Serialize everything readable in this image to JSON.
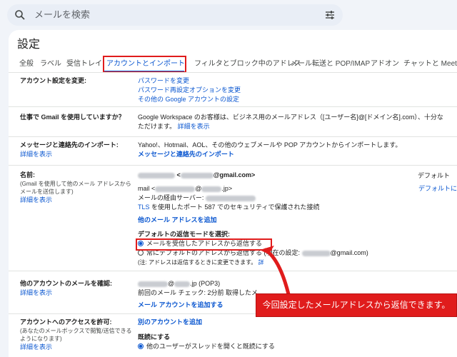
{
  "search": {
    "placeholder": "メールを検索"
  },
  "page_title": "設定",
  "tabs": [
    "全般",
    "ラベル",
    "受信トレイ",
    "アカウントとインポート",
    "フィルタとブロック中のアドレス",
    "メール転送と POP/IMAP",
    "アドオン",
    "チャットと Meet"
  ],
  "active_tab_index": 3,
  "sections": {
    "account": {
      "label": "アカウント設定を変更:",
      "links": [
        "パスワードを変更",
        "パスワード再設定オプションを変更",
        "その他の Google アカウントの設定"
      ]
    },
    "gmail_work": {
      "label": "仕事で Gmail を使用していますか？",
      "line1": "Google Workspace のお客様は、ビジネス用のメールアドレス（[ユーザー名]@[ドメイン名].com）、十分な",
      "line2_text": "ただけます。",
      "line2_link": "詳細を表示"
    },
    "import": {
      "label": "メッセージと連絡先のインポート:",
      "detail_link": "詳細を表示",
      "text": "Yahoo!、Hotmail、AOL、その他のウェブメールや POP アカウントからインポートします。",
      "action_link": "メッセージと連絡先のインポート"
    },
    "name": {
      "label": "名前:",
      "sub": "(Gmail を使用して他のメール アドレスからメールを送信します)",
      "detail_link": "詳細を表示",
      "address1_suffix": "@gmail.com>",
      "address2_prefix": "mail <",
      "address2_suffix": ".jp>",
      "smtp_label": "メールの経由サーバー:",
      "tls_link": "TLS",
      "tls_text": "を使用したポート 587 でのセキュリティで保護された接続",
      "add_link": "他のメール アドレスを追加",
      "default_label": "デフォルト",
      "default_link": "デフォルトに",
      "reply_mode_label": "デフォルトの返信モードを選択:",
      "reply_option1": "メールを受信したアドレスから返信する",
      "reply_option2": "常にデフォルトのアドレスから返信する",
      "current_setting_prefix": "(現在の設定:",
      "current_setting_suffix": "@gmail.com)",
      "note": "(注: アドレスは返信するときに変更できます。",
      "note_link": "詳"
    },
    "check_mail": {
      "label": "他のアカウントのメールを確認:",
      "detail_link": "詳細を表示",
      "account_suffix": ".jp (POP3)",
      "last_check": "前回のメール チェック: 2分前 取得したメ",
      "add_link": "メール アカウントを追加する"
    },
    "access": {
      "label": "アカウントへのアクセスを許可:",
      "sub": "(あなたのメールボックスで閲覧/送信できるようになります)",
      "detail_link": "詳細を表示",
      "add_link": "別のアカウントを追加",
      "read_label": "既読にする",
      "read_option": "他のユーザーがスレッドを開くと既読にする"
    }
  },
  "annotation": {
    "callout": "今回設定したメールアドレスから返信できます。",
    "color": "#e01c1c"
  }
}
